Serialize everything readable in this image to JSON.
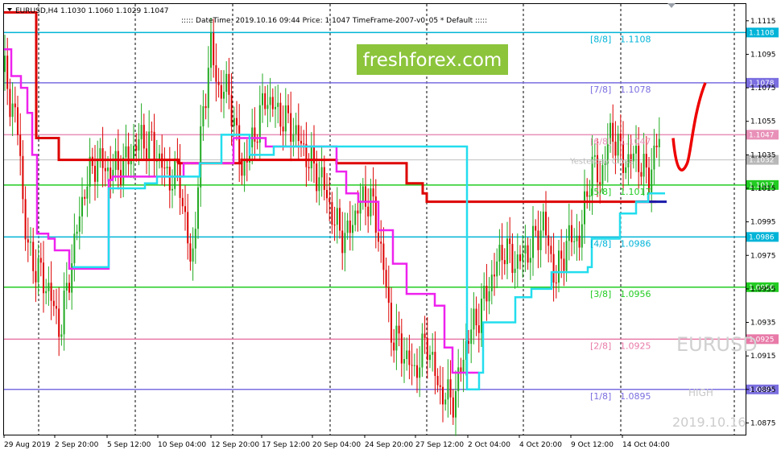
{
  "header": {
    "symbol_line": "EURUSD,H4  1.1030 1.1060 1.1029 1.1047",
    "info_line": "::::: DateTime: 2019.10.16 09:44   Price: 1.1047   TimeFrame-2007-v0_05   *   Default   :::::"
  },
  "watermark": {
    "brand": "freshforex.com",
    "brand_bg": "#8cc43c",
    "symbol": "EURUSD",
    "high": "HIGH",
    "date": "2019.10.16"
  },
  "chart_data": {
    "type": "candlestick",
    "symbol": "EURUSD",
    "timeframe": "H4",
    "ohlc_last": {
      "open": 1.103,
      "high": 1.106,
      "low": 1.1029,
      "close": 1.1047
    },
    "ylim": [
      1.0868,
      1.1125
    ],
    "grid": "vertical dashed",
    "price_ticks": [
      1.1115,
      1.1095,
      1.1075,
      1.1055,
      1.1035,
      1.1015,
      1.0995,
      1.0975,
      1.0955,
      1.0935,
      1.0915,
      1.0895,
      1.0875
    ],
    "date_ticks": [
      "29 Aug 2019",
      "2 Sep 20:00",
      "5 Sep 12:00",
      "10 Sep 04:00",
      "12 Sep 20:00",
      "17 Sep 12:00",
      "20 Sep 04:00",
      "24 Sep 20:00",
      "27 Sep 12:00",
      "2 Oct 04:00",
      "4 Oct 20:00",
      "9 Oct 12:00",
      "14 Oct 04:00"
    ],
    "murrey_levels": [
      {
        "label": "[8/8]",
        "value": 1.1108,
        "tag": "1.1108",
        "color": "#00b4d8"
      },
      {
        "label": "[7/8]",
        "value": 1.1078,
        "tag": "1.1078",
        "color": "#7a6ee0"
      },
      {
        "label": "[6/8]",
        "value": 1.1047,
        "tag": "1.1047",
        "color": "#e890b8"
      },
      {
        "label": "[5/8]",
        "value": 1.1017,
        "tag": "1.1017",
        "color": "#22cc22"
      },
      {
        "label": "[4/8]",
        "value": 1.0986,
        "tag": "1.0986",
        "color": "#00b4d8"
      },
      {
        "label": "[3/8]",
        "value": 1.0956,
        "tag": "1.0956",
        "color": "#22cc22"
      },
      {
        "label": "[2/8]",
        "value": 1.0925,
        "tag": "1.0925",
        "color": "#e87aa8"
      },
      {
        "label": "[1/8]",
        "value": 1.0895,
        "tag": "1.0895",
        "color": "#7a6ee0"
      }
    ],
    "yesterday_close": {
      "label": "Yesterday Close",
      "value": 1.1032,
      "tag": "1.1032"
    },
    "red_forecast": [
      [
        0,
        1.1045
      ],
      [
        0.4,
        1.1025
      ],
      [
        0.7,
        1.103
      ],
      [
        1.0,
        1.106
      ],
      [
        1.6,
        1.1078
      ]
    ],
    "series": [
      {
        "name": "Candles",
        "up_color": "#22aa22",
        "down_color": "#dd0000"
      },
      {
        "color": "#dd0000",
        "kind": "step"
      },
      {
        "color": "#ee22ee",
        "kind": "step"
      },
      {
        "color": "#22ddee",
        "kind": "step"
      }
    ]
  }
}
